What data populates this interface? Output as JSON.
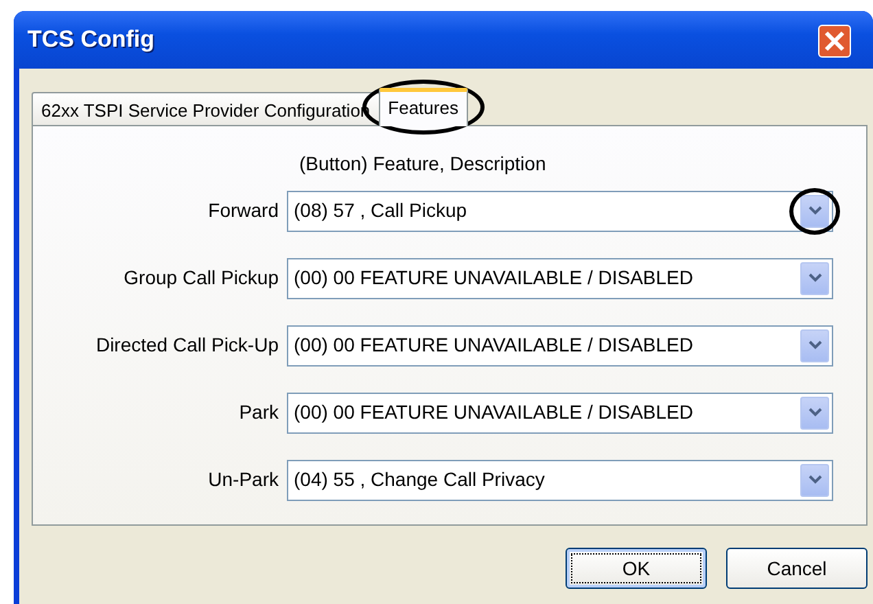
{
  "window": {
    "title": "TCS Config"
  },
  "tabs": [
    {
      "label": "62xx TSPI Service Provider Configuration",
      "selected": false,
      "circled": false
    },
    {
      "label": "Features",
      "selected": true,
      "circled": true
    }
  ],
  "header": "(Button) Feature,  Description",
  "features": [
    {
      "label": "Forward",
      "value": "(08) 57 , Call Pickup",
      "arrow_circled": true
    },
    {
      "label": "Group Call Pickup",
      "value": "(00) 00 FEATURE UNAVAILABLE / DISABLED",
      "arrow_circled": false
    },
    {
      "label": "Directed Call Pick-Up",
      "value": "(00) 00 FEATURE UNAVAILABLE / DISABLED",
      "arrow_circled": false
    },
    {
      "label": "Park",
      "value": "(00) 00 FEATURE UNAVAILABLE / DISABLED",
      "arrow_circled": false
    },
    {
      "label": "Un-Park",
      "value": "(04) 55 , Change Call Privacy",
      "arrow_circled": false
    }
  ],
  "buttons": [
    {
      "label": "OK",
      "default": true
    },
    {
      "label": "Cancel",
      "default": false
    }
  ]
}
